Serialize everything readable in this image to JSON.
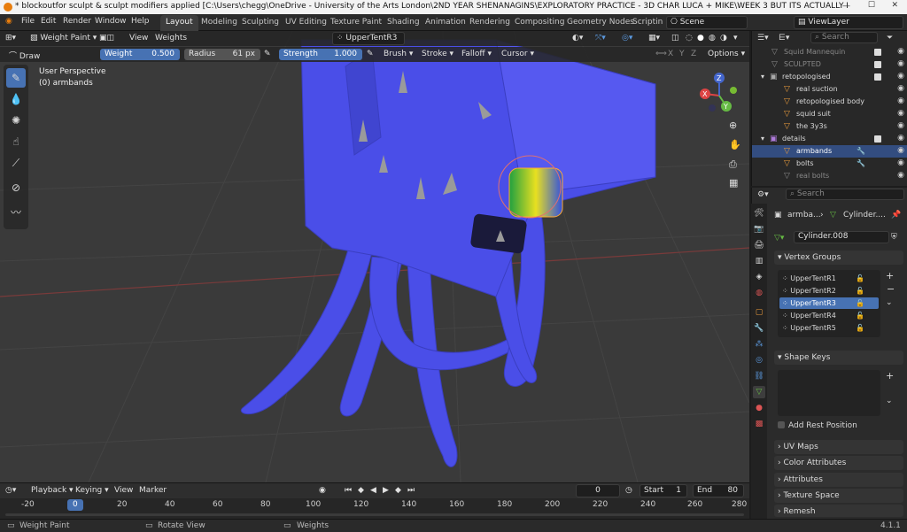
{
  "titlebar": {
    "title": "* blockoutfor sculpt & sculpt modifiers applied [C:\\Users\\chegg\\OneDrive - University of the Arts London\\2ND YEAR SHENANAGINS\\EXPLORATORY PRACTICE - 3D CHAR LUCA + MIKE\\WEEK 3 BUT ITS ACTUALLY EASTER HOLIDAYS IM LAZY\\block..."
  },
  "menu": [
    "File",
    "Edit",
    "Render",
    "Window",
    "Help"
  ],
  "workspaces": [
    "Layout",
    "Modeling",
    "Sculpting",
    "UV Editing",
    "Texture Paint",
    "Shading",
    "Animation",
    "Rendering",
    "Compositing",
    "Geometry Nodes",
    "Scriptin"
  ],
  "scene": {
    "name": "Scene",
    "view_layer": "ViewLayer"
  },
  "viewport_header": {
    "mode": "Weight Paint",
    "view": "View",
    "weights": "Weights",
    "vertex_group": "UpperTentR3"
  },
  "tool_settings": {
    "brush": "Draw",
    "weight_label": "Weight",
    "weight_value": "0.500",
    "radius_label": "Radius",
    "radius_value": "61 px",
    "strength_label": "Strength",
    "strength_value": "1.000",
    "brush_menu": "Brush",
    "stroke_menu": "Stroke",
    "falloff_menu": "Falloff",
    "cursor_menu": "Cursor",
    "axis_x": "X",
    "axis_y": "Y",
    "axis_z": "Z",
    "options": "Options"
  },
  "viewport_info": {
    "perspective": "User Perspective",
    "object": "(0) armbands"
  },
  "gizmo": {
    "x": "X",
    "y": "Y",
    "z": "Z"
  },
  "outliner": {
    "search_placeholder": "Search",
    "rows": [
      {
        "name": "Squid Mannequin",
        "indent": 1,
        "selected": false
      },
      {
        "name": "SCULPTED",
        "indent": 1,
        "selected": false
      },
      {
        "name": "retopologised",
        "indent": 0,
        "selected": false
      },
      {
        "name": "real suction",
        "indent": 1,
        "selected": false
      },
      {
        "name": "retopologised body",
        "indent": 1,
        "selected": false
      },
      {
        "name": "squid suit",
        "indent": 1,
        "selected": false
      },
      {
        "name": "the 3y3s",
        "indent": 1,
        "selected": false
      },
      {
        "name": "details",
        "indent": 0,
        "selected": false
      },
      {
        "name": "armbands",
        "indent": 1,
        "selected": true
      },
      {
        "name": "bolts",
        "indent": 1,
        "selected": false
      },
      {
        "name": "real bolts",
        "indent": 1,
        "selected": false
      }
    ]
  },
  "properties": {
    "search_placeholder": "Search",
    "breadcrumb_object": "armba...",
    "breadcrumb_data": "Cylinder....",
    "mesh_name": "Cylinder.008",
    "vertex_groups_title": "Vertex Groups",
    "vertex_groups": [
      "UpperTentR1",
      "UpperTentR2",
      "UpperTentR3",
      "UpperTentR4",
      "UpperTentR5"
    ],
    "selected_group": "UpperTentR3",
    "shape_keys_title": "Shape Keys",
    "add_rest_position": "Add Rest Position",
    "collapsed_panels": [
      "UV Maps",
      "Color Attributes",
      "Attributes",
      "Texture Space",
      "Remesh"
    ]
  },
  "timeline": {
    "playback": "Playback",
    "keying": "Keying",
    "view": "View",
    "marker": "Marker",
    "current_frame": "0",
    "start_label": "Start",
    "start_value": "1",
    "end_label": "End",
    "end_value": "80",
    "ticks": [
      "-20",
      "0",
      "20",
      "40",
      "60",
      "80",
      "100",
      "120",
      "140",
      "160",
      "180",
      "200",
      "220",
      "240",
      "260",
      "280"
    ]
  },
  "status": {
    "left": "Weight Paint",
    "middle": "Rotate View",
    "right": "Weights",
    "version": "4.1.1"
  },
  "colors": {
    "accent": "#4772b3",
    "mesh": "#4a4ee8",
    "selected_row": "#334d80"
  }
}
